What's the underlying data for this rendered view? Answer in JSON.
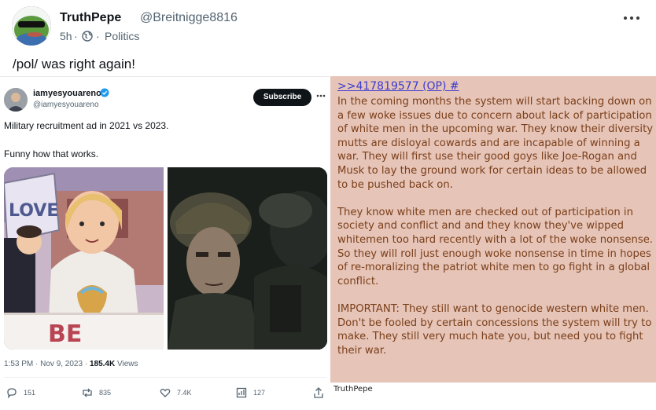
{
  "post": {
    "author_name": "TruthPepe",
    "author_handle": "@Breitnigge8816",
    "time": "5h",
    "separator": "·",
    "category": "Politics",
    "text": "/pol/ was right again!",
    "more_icon": "ellipsis-icon",
    "globe_icon": "globe-icon"
  },
  "tweet": {
    "name": "iamyesyouareno",
    "handle": "@iamyesyouareno",
    "subscribe_label": "Subscribe",
    "text_line1": "Military recruitment ad in 2021 vs 2023.",
    "text_line2": "Funny how that works.",
    "stamp_time": "1:53 PM · Nov 9, 2023 · ",
    "stamp_views_count": "185.4K",
    "stamp_views_label": " Views",
    "sign_text": "LOVE",
    "banner_text": "BE",
    "actions": [
      {
        "icon": "reply-icon",
        "count": "151"
      },
      {
        "icon": "repost-icon",
        "count": "835"
      },
      {
        "icon": "like-icon",
        "count": "7.4K"
      },
      {
        "icon": "bookmark-icon",
        "count": "127"
      },
      {
        "icon": "share-icon",
        "count": ""
      }
    ]
  },
  "chan": {
    "ref": ">>417819577 (OP) #",
    "para1": "In the coming months the system will start backing down on a few woke issues due to concern about lack of participation of white men in the upcoming war. They know their diversity mutts are disloyal cowards and are incapable of winning a war. They will first use their good goys like Joe-Rogan and Musk to lay the ground work for certain ideas to be allowed to be pushed back on.",
    "para2": "They know white men are checked out of participation in society and conflict and and they know they've wipped whitemen too hard recently with a lot of the woke nonsense. So they will roll just enough woke nonsense in time in hopes of re-moralizing the patriot white men to go fight in a global conflict.",
    "para3": "IMPORTANT: They still want to genocide western white men. Don't be fooled by certain concessions the system will try to make. They still very much hate you, but need you to fight their war.",
    "credit": "TruthPepe"
  },
  "colors": {
    "chan_background": "#e6c4b7",
    "chan_text": "#7a3f1a",
    "chan_link": "#3a3ad0",
    "verified": "#1d9bf0"
  }
}
